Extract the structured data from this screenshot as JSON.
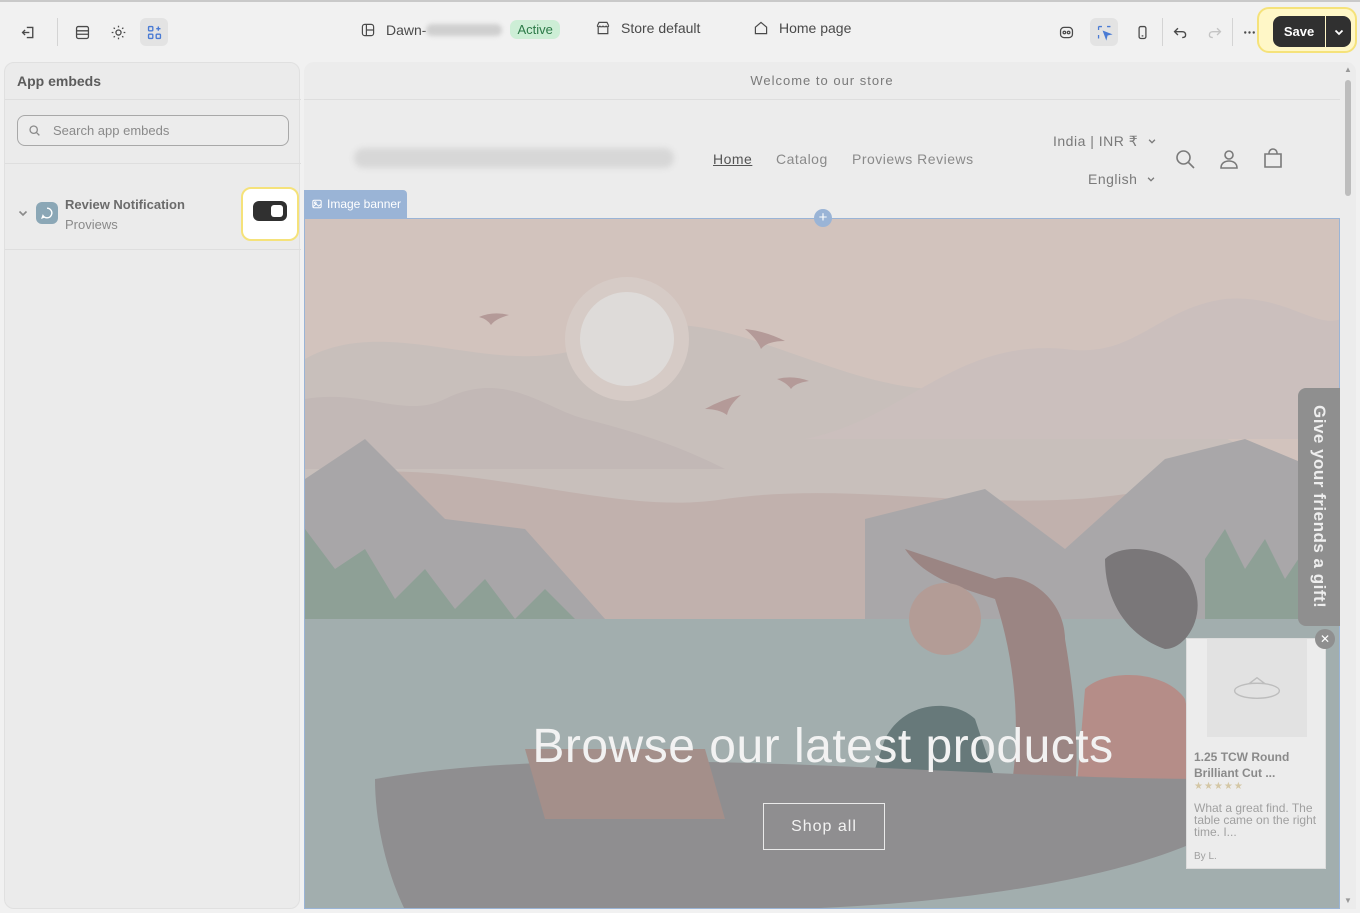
{
  "topbar": {
    "theme_name": "Dawn-",
    "theme_status": "Active",
    "store_label": "Store default",
    "page_label": "Home page",
    "save_label": "Save"
  },
  "panel": {
    "title": "App embeds",
    "search_placeholder": "Search app embeds",
    "embeds": [
      {
        "name": "Review Notification",
        "provider": "Proviews",
        "enabled": true
      }
    ]
  },
  "store": {
    "announcement": "Welcome to our store",
    "nav": [
      "Home",
      "Catalog",
      "Proviews Reviews"
    ],
    "country": "India | INR ₹",
    "language": "English",
    "banner_tag": "Image banner",
    "hero_title": "Browse our latest products",
    "hero_button": "Shop all",
    "gift_tab": "Give your friends a gift!"
  },
  "popup": {
    "product_name": "1.25 TCW Round Brilliant Cut ...",
    "rating": 5,
    "stars": "★★★★★",
    "review": "What a great find. The table came on the right time. I...",
    "author": "By L.",
    "close": "✕"
  },
  "colors": {
    "accent": "#9ab4d6",
    "save": "#303030",
    "highlight": "#f5e27a",
    "badge_bg": "#cdeed6"
  }
}
